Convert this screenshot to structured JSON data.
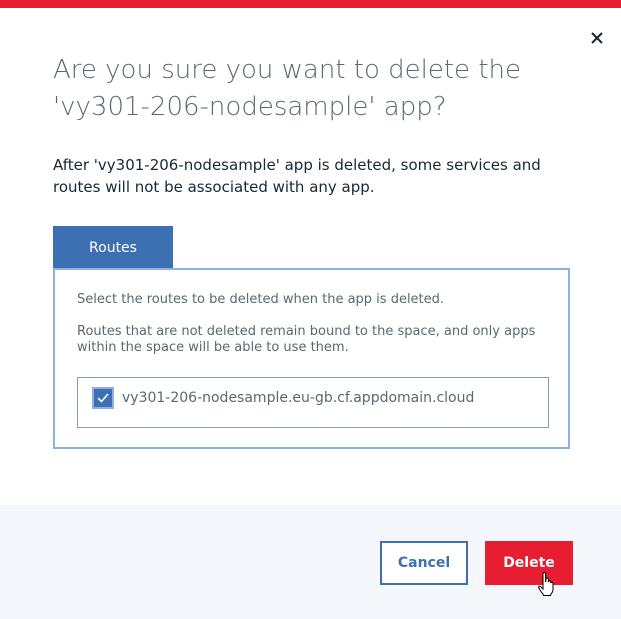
{
  "dialog": {
    "title": "Are you sure you want to delete the 'vy301-206-nodesample' app?",
    "description": "After 'vy301-206-nodesample' app is deleted, some services and routes will not be associated with any app.",
    "close_icon": "close-icon"
  },
  "routes_tab": {
    "label": "Routes",
    "instruction": "Select the routes to be deleted when the app is deleted.",
    "note": "Routes that are not deleted remain bound to the space, and only apps within the space will be able to use them.",
    "items": [
      {
        "label": "vy301-206-nodesample.eu-gb.cf.appdomain.cloud",
        "checked": true
      }
    ]
  },
  "footer": {
    "cancel_label": "Cancel",
    "delete_label": "Delete"
  },
  "colors": {
    "accent": "#3d70b2",
    "danger": "#e71d32",
    "footer_bg": "#f4f7fb"
  }
}
